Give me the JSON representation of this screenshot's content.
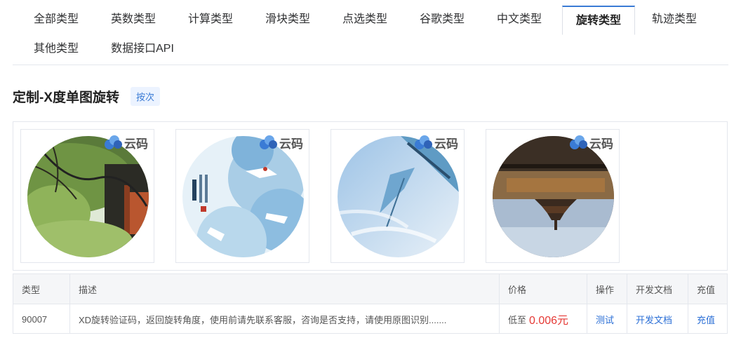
{
  "tabs": [
    {
      "label": "全部类型",
      "active": false
    },
    {
      "label": "英数类型",
      "active": false
    },
    {
      "label": "计算类型",
      "active": false
    },
    {
      "label": "滑块类型",
      "active": false
    },
    {
      "label": "点选类型",
      "active": false
    },
    {
      "label": "谷歌类型",
      "active": false
    },
    {
      "label": "中文类型",
      "active": false
    },
    {
      "label": "旋转类型",
      "active": true
    },
    {
      "label": "轨迹类型",
      "active": false
    },
    {
      "label": "其他类型",
      "active": false
    },
    {
      "label": "数据接口API",
      "active": false
    }
  ],
  "section": {
    "title": "定制-X度单图旋转",
    "badge": "按次"
  },
  "samples": [
    {
      "watermark": "云码",
      "scene": "tree-building"
    },
    {
      "watermark": "云码",
      "scene": "cranes-illustration"
    },
    {
      "watermark": "云码",
      "scene": "sky-sail"
    },
    {
      "watermark": "云码",
      "scene": "pagoda-reflection"
    }
  ],
  "table": {
    "headers": {
      "type": "类型",
      "desc": "描述",
      "price": "价格",
      "action": "操作",
      "docs": "开发文档",
      "recharge": "充值"
    },
    "row": {
      "type": "90007",
      "desc": "XD旋转验证码，返回旋转角度，使用前请先联系客服，咨询是否支持，请使用原图识别.......",
      "price_prefix": "低至",
      "price_value": "0.006元",
      "action": "测试",
      "docs": "开发文档",
      "recharge": "充值"
    }
  },
  "colors": {
    "accent": "#3a7bd5",
    "price": "#e53935",
    "link": "#2b6fd6"
  }
}
